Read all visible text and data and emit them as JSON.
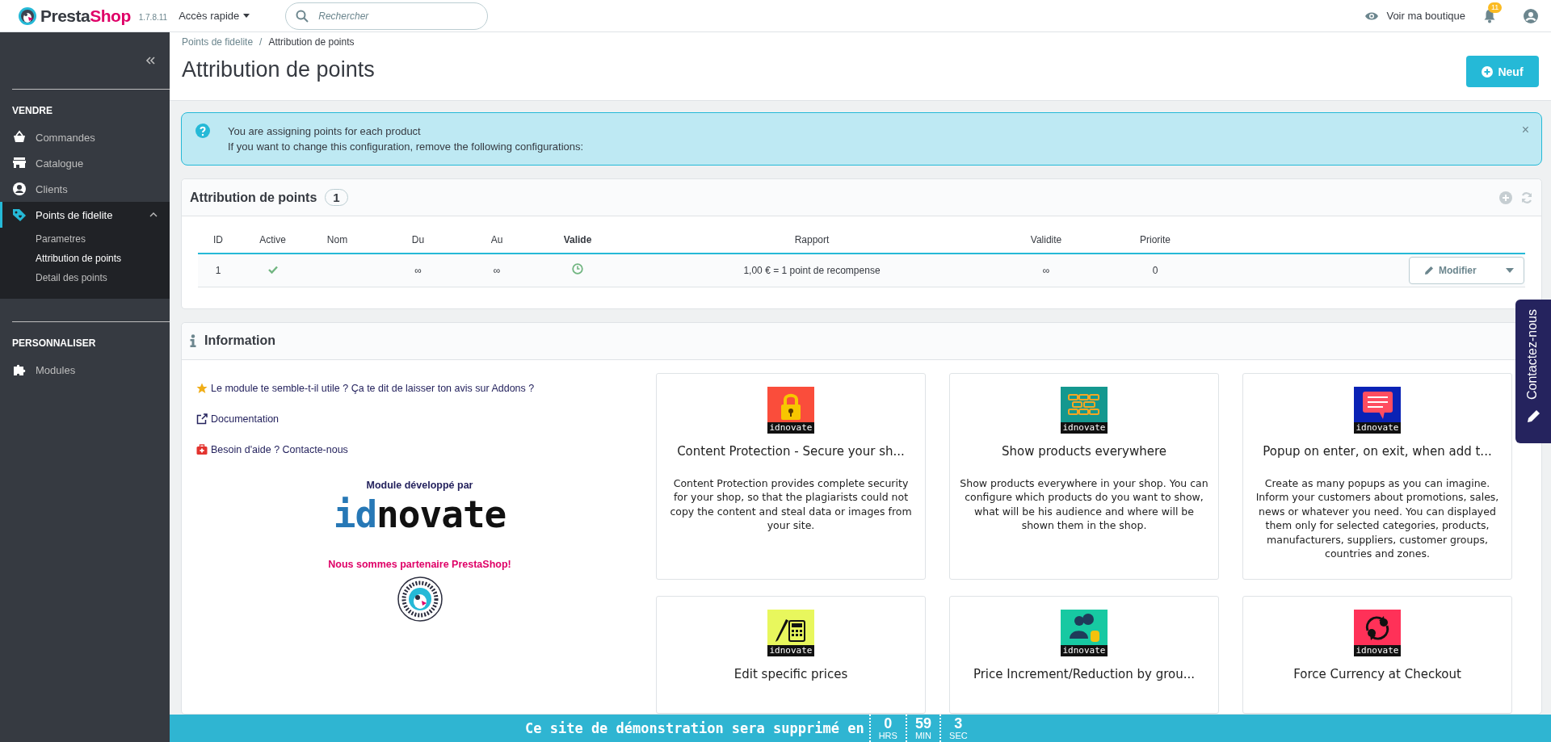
{
  "header": {
    "brand_part1": "Presta",
    "brand_part2": "Shop",
    "version": "1.7.8.11",
    "quick_access": "Accès rapide",
    "search": {
      "placeholder": "Rechercher"
    },
    "view_shop": "Voir ma boutique",
    "notifications": "11"
  },
  "sidebar": {
    "sections": [
      {
        "title": "VENDRE",
        "items": [
          {
            "label": "Commandes",
            "kind": "basket",
            "selected": false
          },
          {
            "label": "Catalogue",
            "kind": "store",
            "selected": false
          },
          {
            "label": "Clients",
            "kind": "user",
            "selected": false
          },
          {
            "label": "Points de fidelite",
            "kind": "tag",
            "selected": true,
            "expanded": true,
            "children": [
              {
                "label": "Parametres",
                "selected": false
              },
              {
                "label": "Attribution de points",
                "selected": true
              },
              {
                "label": "Detail des points",
                "selected": false
              }
            ]
          }
        ]
      },
      {
        "title": "PERSONNALISER",
        "items": [
          {
            "label": "Modules",
            "kind": "puzzle",
            "selected": false
          }
        ]
      }
    ]
  },
  "breadcrumb": {
    "items": [
      "Points de fidelite",
      "Attribution de points"
    ],
    "separator": "/"
  },
  "page_title": "Attribution de points",
  "new_button": "Neuf",
  "alert": {
    "lines": [
      "You are assigning points for each product",
      "If you want to change this configuration, remove the following configurations:"
    ],
    "close": "×"
  },
  "table_panel": {
    "title": "Attribution de points",
    "count": "1",
    "columns": [
      {
        "label": "ID",
        "sorted": false
      },
      {
        "label": "Active",
        "sorted": false
      },
      {
        "label": "Nom",
        "sorted": false
      },
      {
        "label": "Du",
        "sorted": false
      },
      {
        "label": "Au",
        "sorted": false
      },
      {
        "label": "Valide",
        "sorted": true
      },
      {
        "label": "Rapport",
        "sorted": false
      },
      {
        "label": "Validite",
        "sorted": false
      },
      {
        "label": "Priorite",
        "sorted": false
      }
    ],
    "rows": [
      {
        "id": "1",
        "active": true,
        "name": "",
        "from": "∞",
        "to": "∞",
        "valid": true,
        "ratio": "1,00 € = 1 point de recompense",
        "validity": "∞",
        "priority": "0",
        "action": "Modifier"
      }
    ]
  },
  "info_panel": {
    "title": "Information",
    "links": [
      {
        "kind": "star",
        "text": "Le module te semble-t-il utile ? Ça te dit de laisser ton avis sur Addons ?"
      },
      {
        "kind": "external",
        "text": "Documentation"
      },
      {
        "kind": "help",
        "text": "Besoin d'aide ? Contacte-nous"
      }
    ],
    "developer_label": "Module développé par",
    "logo_part1": "id",
    "logo_part2": "novate",
    "partner_label": "Nous sommes partenaire PrestaShop!",
    "modules": [
      {
        "kind": "lock",
        "brand": "idnovate",
        "title": "Content Protection - Secure your sh...",
        "description": "Content Protection provides complete security for your shop, so that the plagiarists could not copy the content and steal data or images from your site."
      },
      {
        "kind": "bricks",
        "brand": "idnovate",
        "title": "Show products everywhere",
        "description": "Show products everywhere in your shop. You can configure which products do you want to show, what will be his audience and where will be shown them in the shop."
      },
      {
        "kind": "chat",
        "brand": "idnovate",
        "title": "Popup on enter, on exit, when add t...",
        "description": "Create as many popups as you can imagine. Inform your customers about promotions, sales, news or whatever you need. You can displayed them only for selected categories, products, manufacturers, suppliers, customer groups, countries and zones."
      },
      {
        "kind": "calculator",
        "brand": "idnovate",
        "title": "Edit specific prices"
      },
      {
        "kind": "users",
        "brand": "idnovate",
        "title": "Price Increment/Reduction by grou..."
      },
      {
        "kind": "currency",
        "brand": "idnovate",
        "title": "Force Currency at Checkout"
      }
    ]
  },
  "contact_tab": "Contactez-nous",
  "demo_bar": {
    "message": "Ce site de démonstration sera supprimé en",
    "countdown": [
      {
        "value": "0",
        "unit": "HRS"
      },
      {
        "value": "59",
        "unit": "MIN"
      },
      {
        "value": "3",
        "unit": "SEC"
      }
    ]
  }
}
